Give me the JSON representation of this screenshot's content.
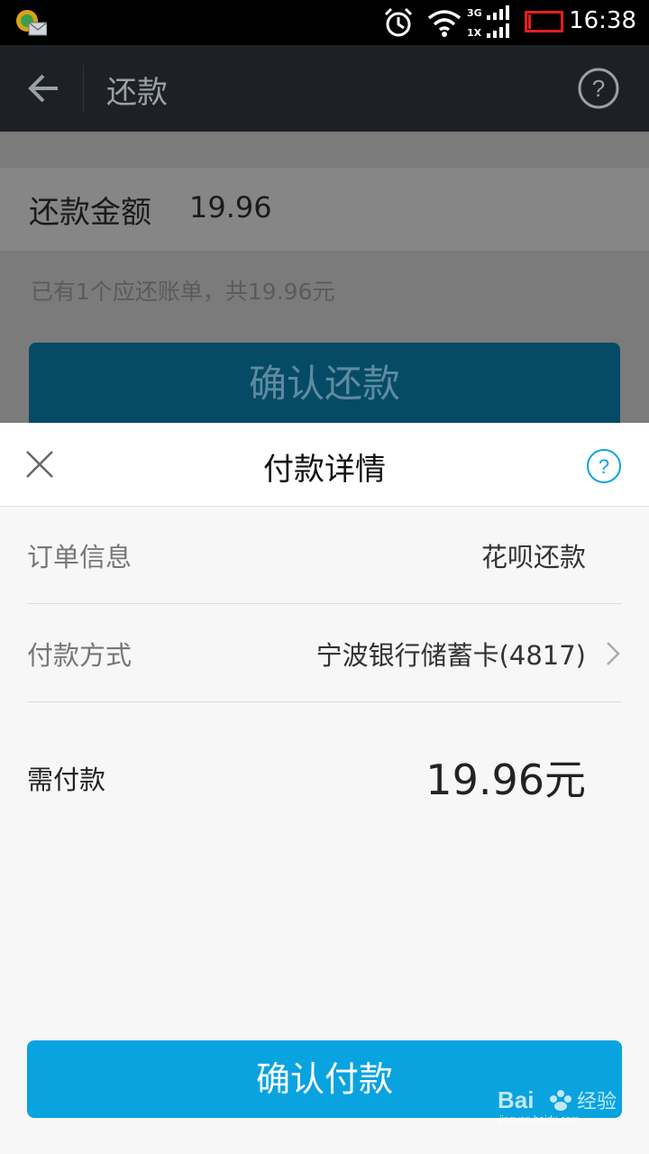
{
  "status_bar": {
    "time": "16:38",
    "net_top": "3G",
    "net_bottom": "1X"
  },
  "header": {
    "title": "还款"
  },
  "background": {
    "amount_label": "还款金额",
    "amount_value": "19.96",
    "bill_note": "已有1个应还账单，共19.96元",
    "confirm_button": "确认还款"
  },
  "sheet": {
    "title": "付款详情",
    "order_label": "订单信息",
    "order_value": "花呗还款",
    "method_label": "付款方式",
    "method_value": "宁波银行储蓄卡(4817)",
    "due_label": "需付款",
    "due_value": "19.96元",
    "pay_button": "确认付款"
  },
  "colors": {
    "accent": "#09a3e0",
    "header_bg": "#1d2126"
  }
}
